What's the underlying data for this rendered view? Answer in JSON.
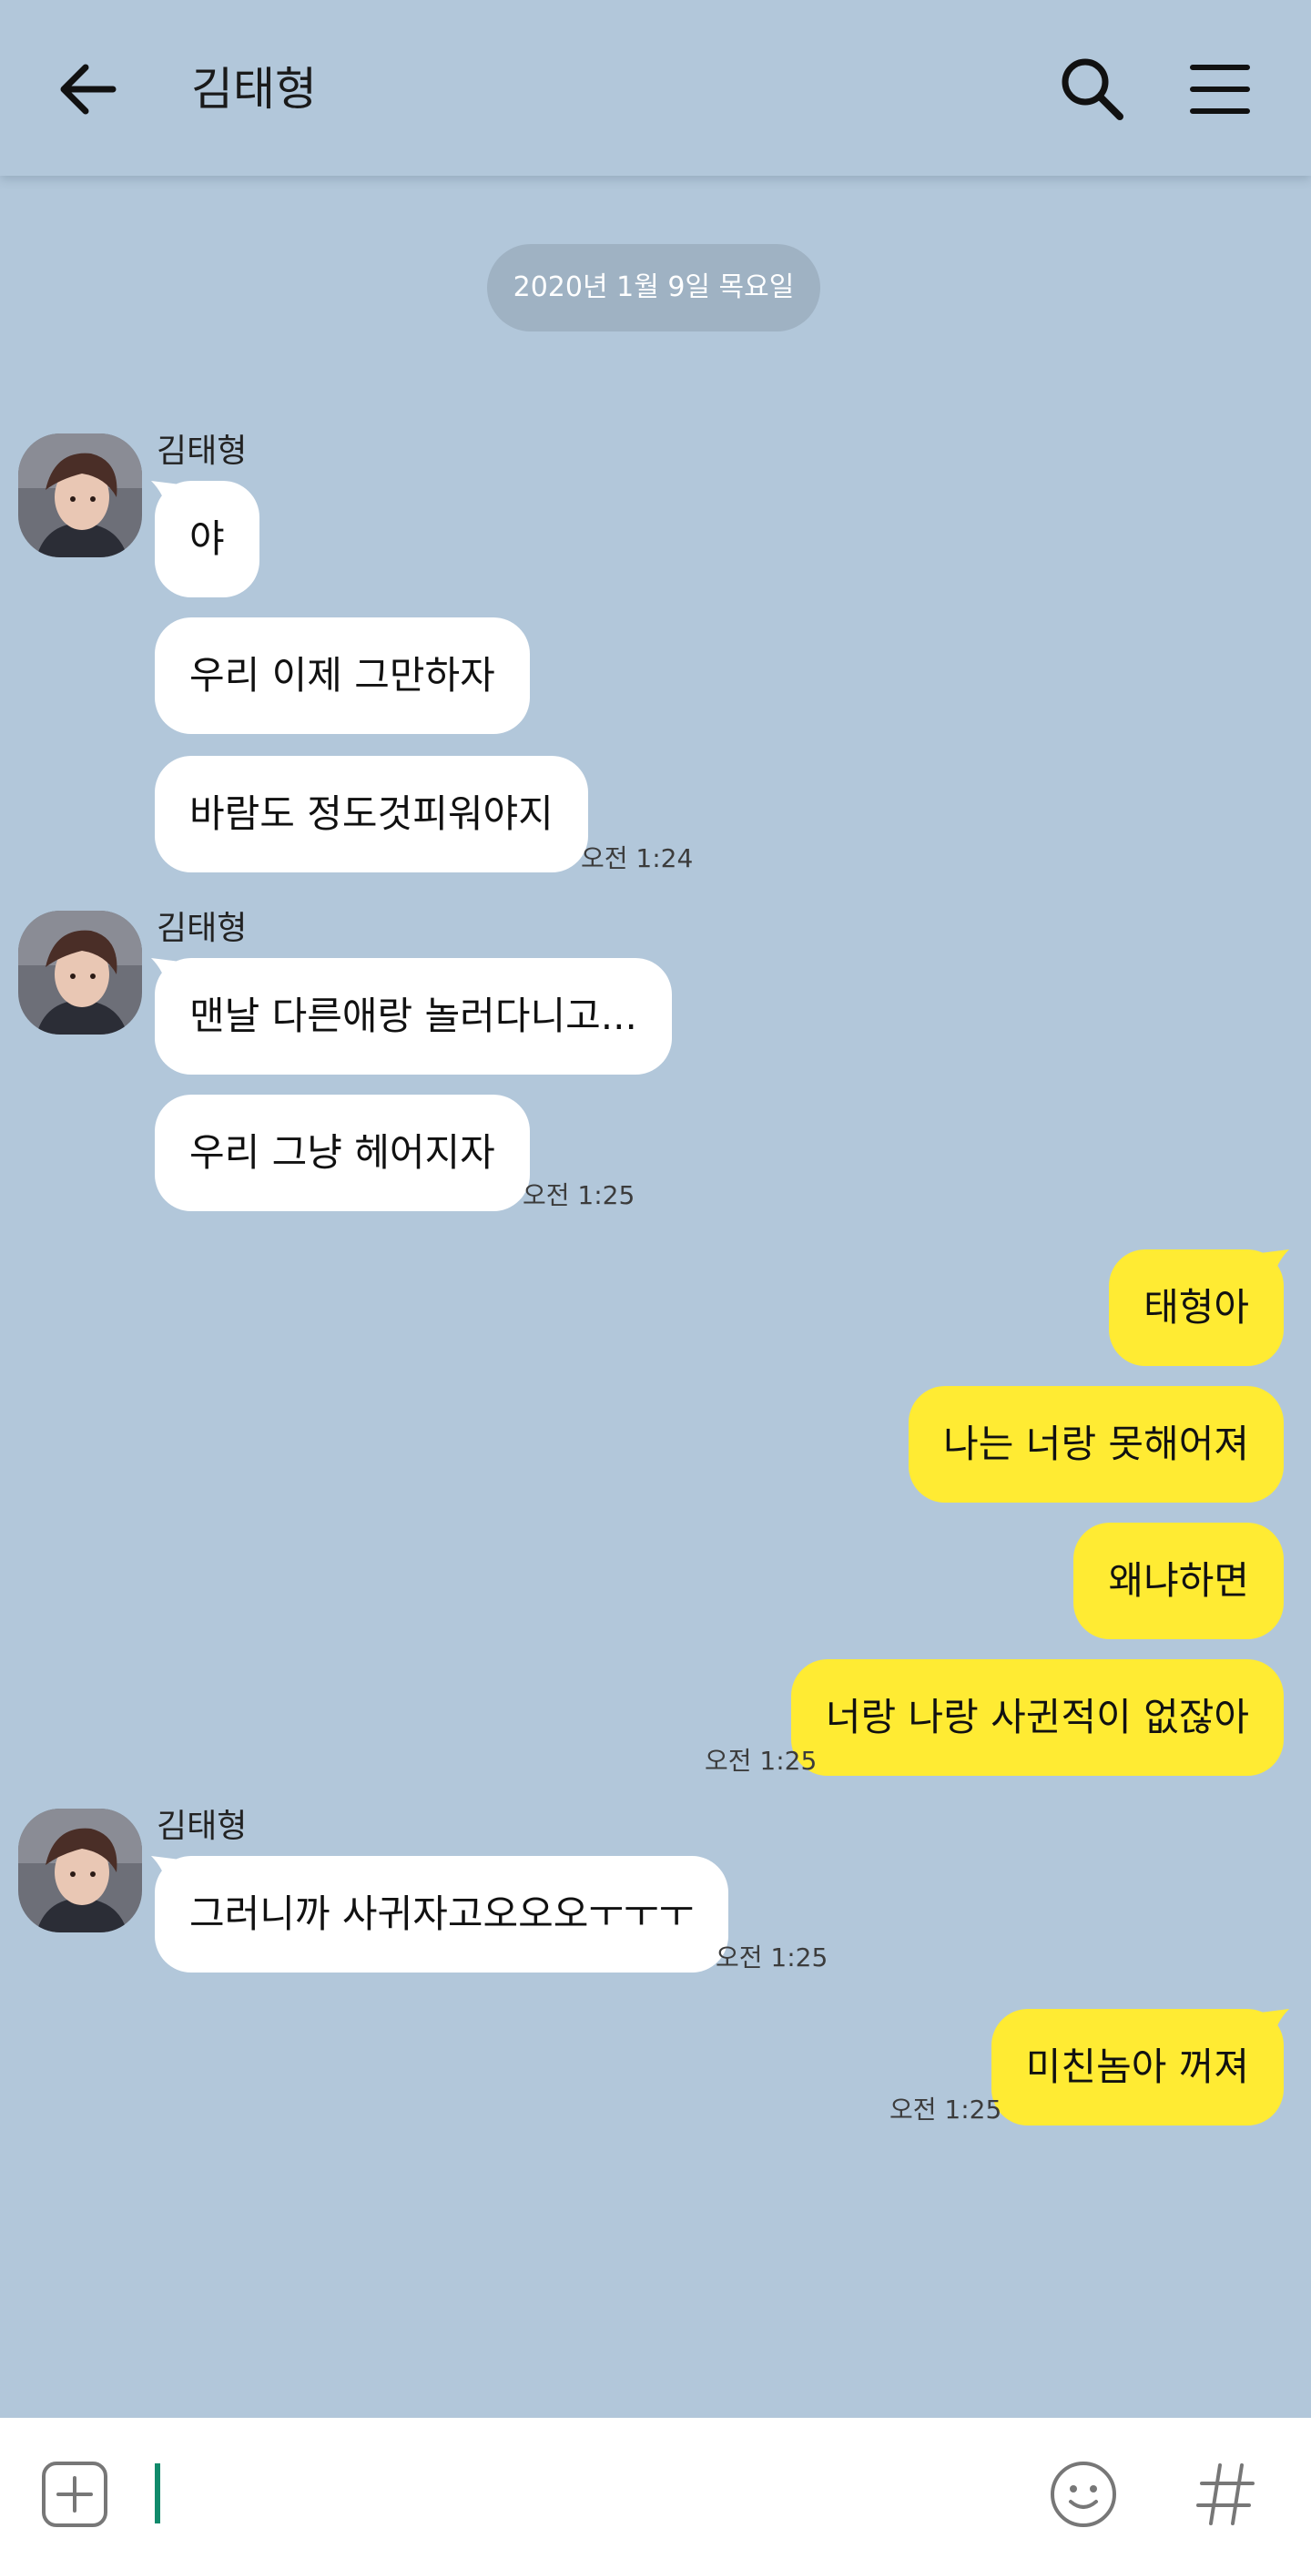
{
  "header": {
    "title": "김태형"
  },
  "date_divider": "2020년 1월 9일 목요일",
  "messages": {
    "g1": {
      "sender": "김태형",
      "m1": "야",
      "m2": "우리 이제 그만하자",
      "m3": "바람도 정도것피워야지",
      "time": "오전 1:24"
    },
    "g2": {
      "sender": "김태형",
      "m1": "맨날 다른애랑 놀러다니고...",
      "m2": "우리 그냥 헤어지자",
      "time": "오전 1:25"
    },
    "g3": {
      "m1": "태형아",
      "m2": "나는 너랑 못해어져",
      "m3": "왜냐하면",
      "m4": "너랑 나랑 사귄적이 없잖아",
      "time": "오전 1:25"
    },
    "g4": {
      "sender": "김태형",
      "m1": "그러니까 사귀자고오오오ㅜㅜㅜ",
      "time": "오전 1:25"
    },
    "g5": {
      "m1": "미친놈아 꺼져",
      "time": "오전 1:25"
    }
  },
  "colors": {
    "background": "#b2c7da",
    "incoming_bubble": "#ffffff",
    "outgoing_bubble": "#ffeb33",
    "cursor": "#118a6b"
  },
  "icons": [
    "arrow-back-icon",
    "search-icon",
    "menu-icon",
    "plus-icon",
    "emoji-icon",
    "hash-icon"
  ]
}
